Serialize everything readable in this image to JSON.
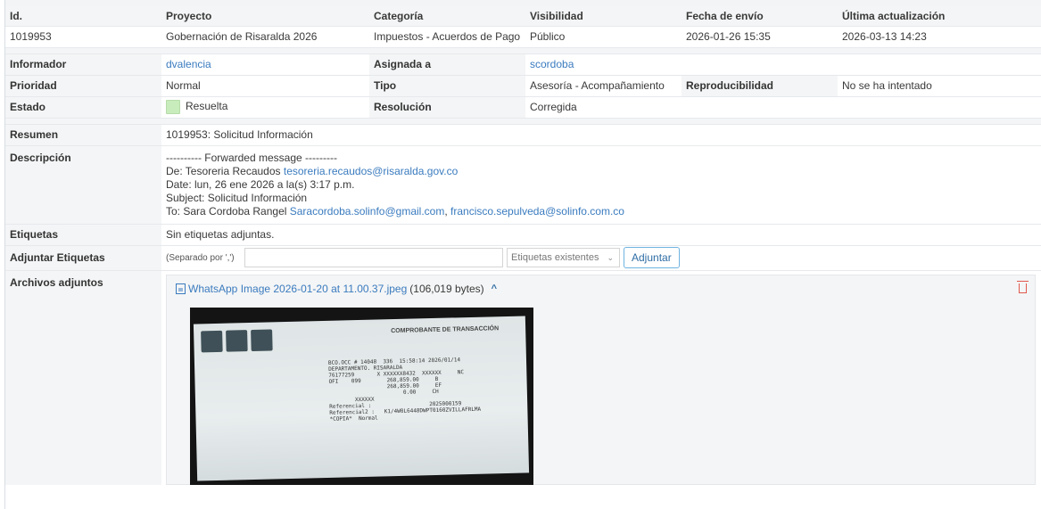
{
  "header": {
    "id": "Id.",
    "project": "Proyecto",
    "category": "Categoría",
    "visibility": "Visibilidad",
    "submitted": "Fecha de envío",
    "updated": "Última actualización"
  },
  "issue": {
    "id": "1019953",
    "project": "Gobernación de Risaralda 2026",
    "category": "Impuestos - Acuerdos de Pago",
    "visibility": "Público",
    "submitted": "2026-01-26 15:35",
    "updated": "2026-03-13 14:23"
  },
  "labels": {
    "reporter": "Informador",
    "assigned": "Asignada a",
    "priority": "Prioridad",
    "type": "Tipo",
    "reproducibility": "Reproducibilidad",
    "status": "Estado",
    "resolution": "Resolución",
    "summary": "Resumen",
    "description": "Descripción",
    "tags": "Etiquetas",
    "attach_tags": "Adjuntar Etiquetas",
    "attachments": "Archivos adjuntos"
  },
  "values": {
    "reporter": "dvalencia",
    "assigned": "scordoba",
    "priority": "Normal",
    "type": "Asesoría - Acompañamiento",
    "reproducibility": "No se ha intentado",
    "status": "Resuelta",
    "status_color": "#c9ecbd",
    "resolution": "Corregida",
    "summary": "1019953: Solicitud Información",
    "tags": "Sin etiquetas adjuntas."
  },
  "description": {
    "line1": "---------- Forwarded message ---------",
    "from_prefix": "De: Tesoreria Recaudos ",
    "from_email": "tesoreria.recaudos@risaralda.gov.co",
    "date": "Date: lun, 26 ene 2026 a la(s) 3:17 p.m.",
    "subject": "Subject: Solicitud Información",
    "to_prefix": "To: Sara Cordoba Rangel ",
    "to_email1": "Saracordoba.solinfo@gmail.com",
    "to_sep": ", ",
    "to_email2": "francisco.sepulveda@solinfo.com.co"
  },
  "tag_form": {
    "hint": "(Separado por ',')",
    "select_label": "Etiquetas existentes",
    "button": "Adjuntar"
  },
  "attachment": {
    "filename": "WhatsApp Image 2026-01-20 at 11.00.37.jpeg",
    "size": "(106,019 bytes)"
  },
  "receipt": {
    "title": "COMPROBANTE DE TRANSACCIÓN",
    "text": "BCO.OCC # 14048  336  15:58:14 2026/01/14\nDEPARTAMENTO. RISARALDA\n76177259       X XXXXXX8432  XXXXXX     NC\nOFI    099        268,859.00     B\n                  268,859.00     EF\n                       0.00     CH\n        XXXXXX\nReferencial :                  2025000159\nReferencial2 :   K1/4W0L6448DWPT0160ZVILLAFRLMA\n*COPIA*  Normal"
  },
  "colors": {
    "link": "#3a7bbf",
    "label_bg": "#f4f5f6",
    "delete": "#e05a4f"
  }
}
